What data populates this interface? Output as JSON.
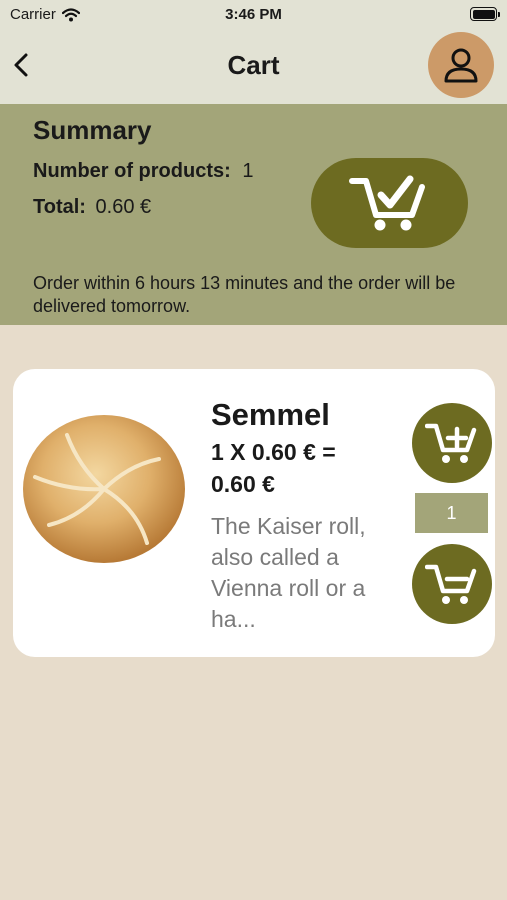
{
  "status_bar": {
    "carrier": "Carrier",
    "time": "3:46 PM"
  },
  "nav": {
    "title": "Cart"
  },
  "summary": {
    "title": "Summary",
    "products_label": "Number of products:",
    "products_value": "1",
    "total_label": "Total:",
    "total_value": "0.60 €",
    "delivery_note": "Order within 6 hours 13 minutes and the order will be delivered tomorrow."
  },
  "cart_items": [
    {
      "name": "Semmel",
      "price_line": "1 X 0.60 € = 0.60 €",
      "description": "The Kaiser roll, also called a Vienna roll or a ha...",
      "quantity": "1"
    }
  ],
  "icons": {
    "back": "chevron-left-icon",
    "profile": "person-icon",
    "checkout": "cart-check-icon",
    "add": "cart-plus-icon",
    "remove": "cart-minus-icon",
    "wifi": "wifi-icon",
    "battery": "battery-icon"
  },
  "colors": {
    "header_bg": "#e2e2d4",
    "summary_bg": "#a3a579",
    "page_bg": "#e7dccb",
    "accent_olive": "#6d6b21",
    "profile_bg": "#cc9a68",
    "quantity_bg": "#a3a579"
  }
}
